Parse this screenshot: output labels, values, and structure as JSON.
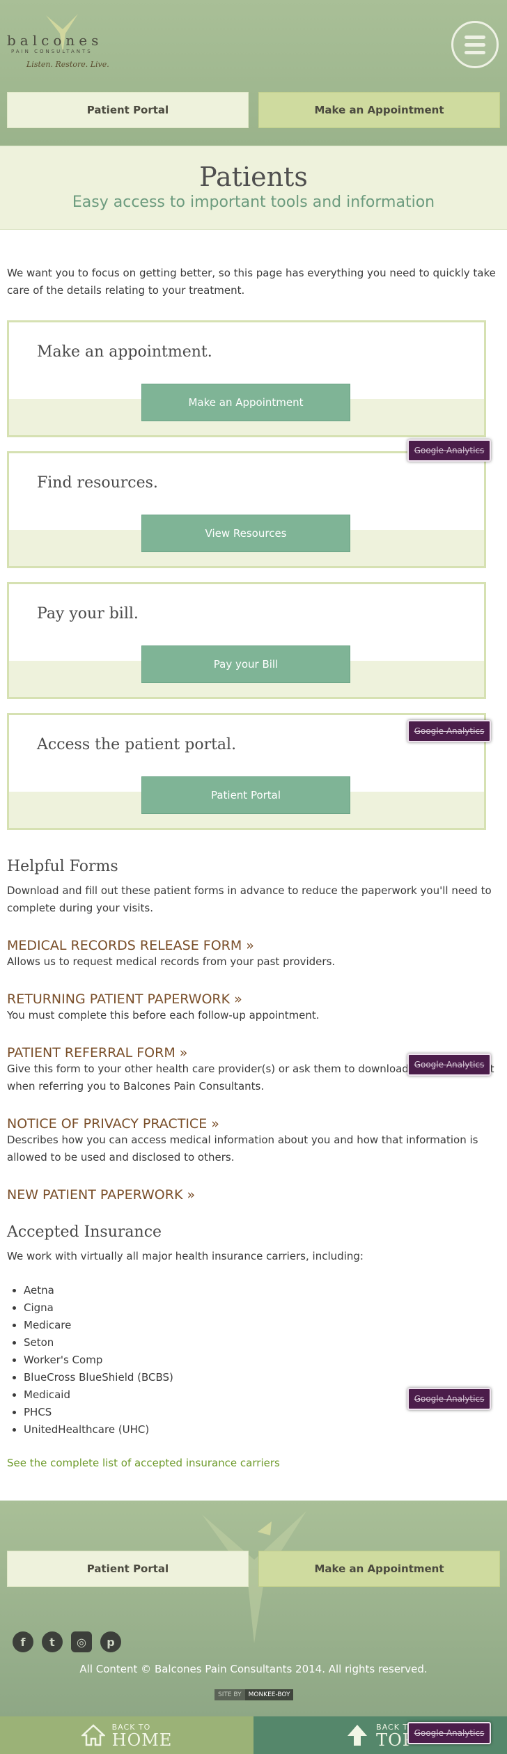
{
  "header": {
    "logo": {
      "word": "balcones",
      "sub": "PAIN CONSULTANTS",
      "tagline": "Listen. Restore. Live."
    },
    "menu_icon": "hamburger-icon",
    "buttons": {
      "portal": "Patient Portal",
      "appointment": "Make an Appointment"
    }
  },
  "title": {
    "heading": "Patients",
    "subheading": "Easy access to important tools and information"
  },
  "intro": "We want you to focus on getting better, so this page has everything you need to quickly take care of the details relating to your treatment.",
  "cards": [
    {
      "heading": "Make an appointment.",
      "button": "Make an Appointment"
    },
    {
      "heading": "Find resources.",
      "button": "View Resources"
    },
    {
      "heading": "Pay your bill.",
      "button": "Pay your Bill"
    },
    {
      "heading": "Access the patient portal.",
      "button": "Patient Portal"
    }
  ],
  "ga_label": "Google Analytics",
  "forms": {
    "heading": "Helpful Forms",
    "intro": "Download and fill out these patient forms in advance to reduce the paperwork you'll need to complete during your visits.",
    "items": [
      {
        "title": "MEDICAL RECORDS RELEASE FORM »",
        "desc": "Allows us to request medical records from your past providers."
      },
      {
        "title": "RETURNING PATIENT PAPERWORK »",
        "desc": "You must complete this before each follow-up appointment."
      },
      {
        "title": "PATIENT REFERRAL FORM »",
        "desc": "Give this form to your other health care provider(s) or ask them to download and complete it when referring you to Balcones Pain Consultants."
      },
      {
        "title": "NOTICE OF PRIVACY PRACTICE »",
        "desc": "Describes how you can access medical information about you and how that information is allowed to be used and disclosed to others."
      },
      {
        "title": "NEW PATIENT PAPERWORK »",
        "desc": ""
      }
    ]
  },
  "insurance": {
    "heading": "Accepted Insurance",
    "intro": "We work with virtually all major health insurance carriers, including:",
    "carriers": [
      "Aetna",
      "Cigna",
      "Medicare",
      "Seton",
      "Worker's Comp",
      "BlueCross BlueShield (BCBS)",
      "Medicaid",
      "PHCS",
      "UnitedHealthcare (UHC)"
    ],
    "link": "See the complete list of accepted insurance carriers"
  },
  "footer": {
    "buttons": {
      "portal": "Patient Portal",
      "appointment": "Make an Appointment"
    },
    "socials": [
      "facebook-icon",
      "twitter-icon",
      "instagram-icon",
      "pinterest-icon"
    ],
    "copyright": "All Content © Balcones Pain Consultants 2014. All rights reserved.",
    "siteby": {
      "label": "SITE BY",
      "name": "MONKEE-BOY"
    }
  },
  "bottom_bar": {
    "home": {
      "small": "BACK TO",
      "big": "HOME",
      "icon": "home-icon"
    },
    "top": {
      "small": "BACK TO",
      "big": "TOP",
      "icon": "arrow-up-icon"
    }
  },
  "colors": {
    "accent_green": "#7fb496",
    "pale_green": "#eef2dc",
    "link_brown": "#7a4f2a",
    "ga_purple": "#4b1d4a"
  }
}
